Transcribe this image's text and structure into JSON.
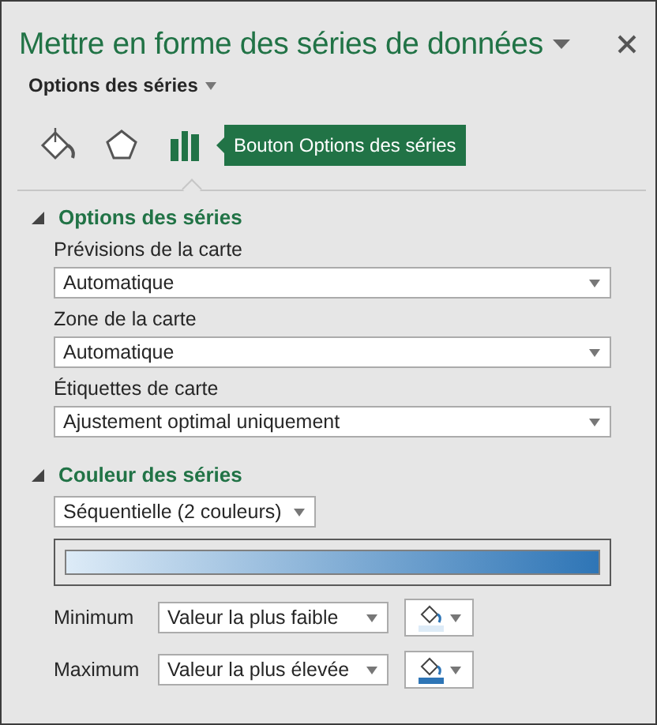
{
  "pane": {
    "title": "Mettre en forme des séries de données",
    "subtitle": "Options des séries"
  },
  "tabs": [
    {
      "kind": "fill",
      "selected": false
    },
    {
      "kind": "effects",
      "selected": false
    },
    {
      "kind": "series",
      "selected": true
    }
  ],
  "tooltip": "Bouton Options des séries",
  "series_options": {
    "heading": "Options des séries",
    "expanded": true,
    "fields": [
      {
        "label": "Prévisions de la carte",
        "value": "Automatique"
      },
      {
        "label": "Zone de la carte",
        "value": "Automatique"
      },
      {
        "label": "Étiquettes de carte",
        "value": "Ajustement optimal uniquement"
      }
    ]
  },
  "series_color": {
    "heading": "Couleur des séries",
    "expanded": true,
    "scheme": "Séquentielle (2 couleurs)",
    "stops": [
      {
        "label": "Minimum",
        "value": "Valeur la plus faible",
        "color": "#ddebf7"
      },
      {
        "label": "Maximum",
        "value": "Valeur la plus élevée",
        "color": "#2e75b6"
      }
    ]
  }
}
